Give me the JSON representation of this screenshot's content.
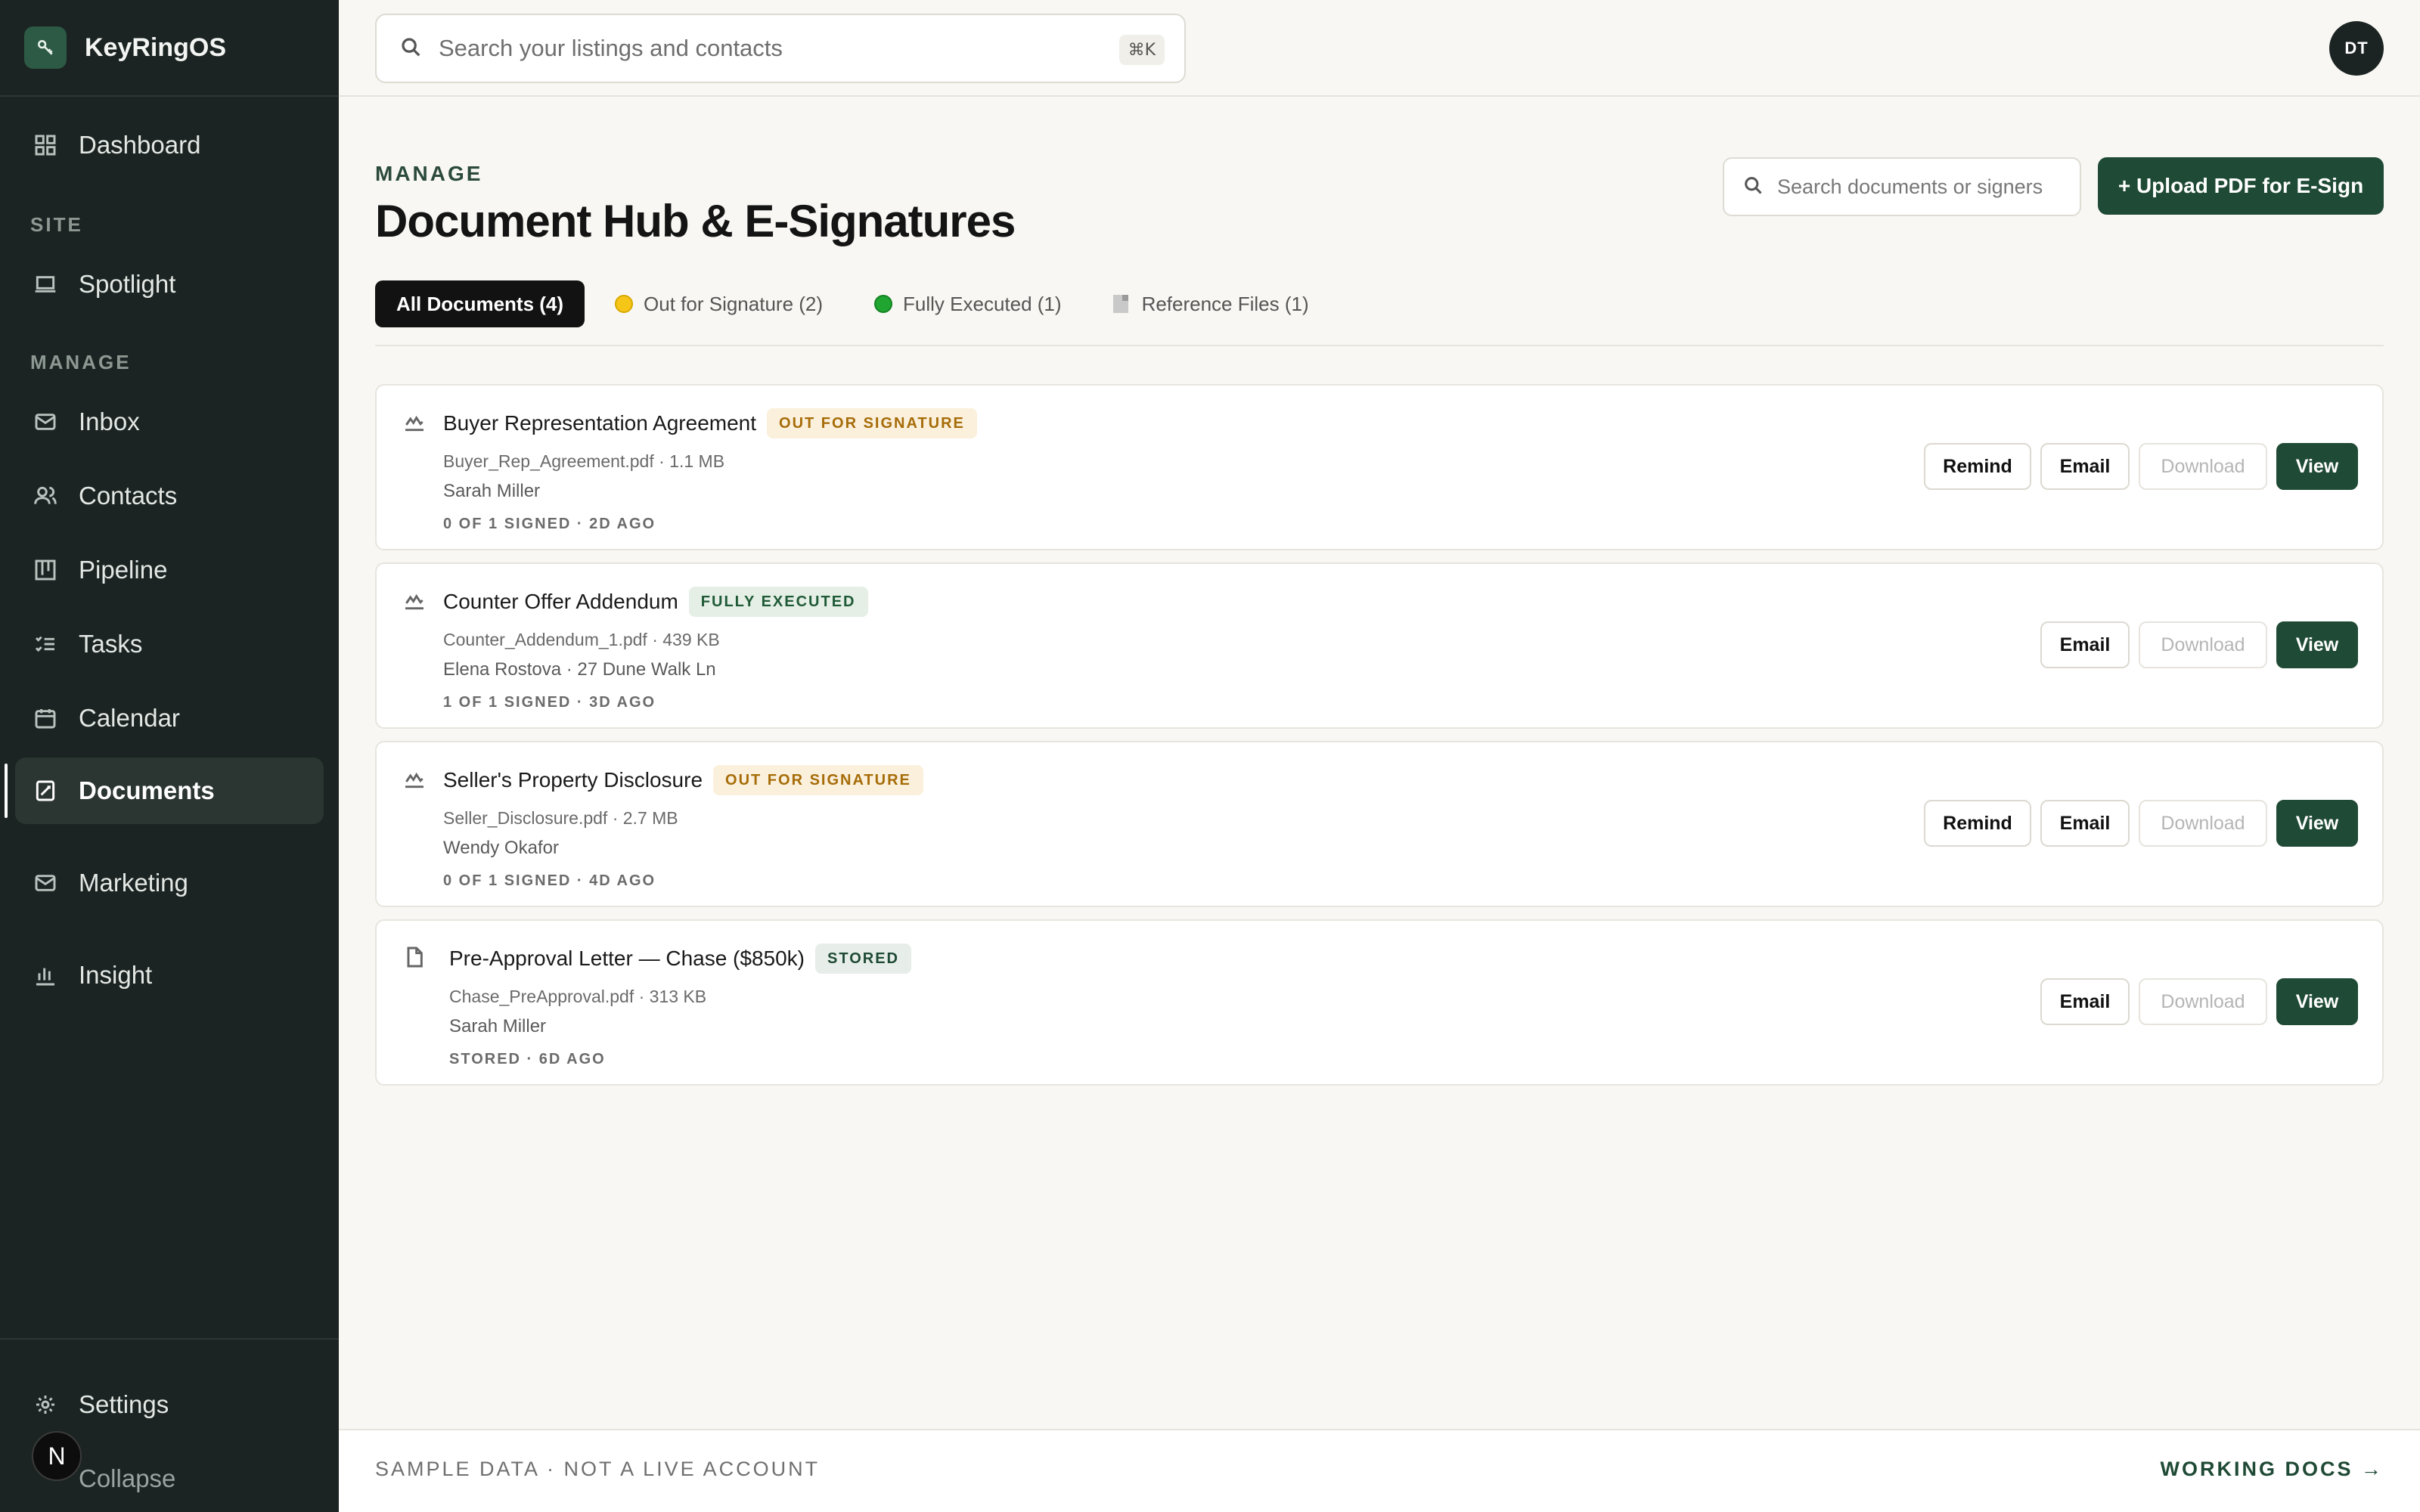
{
  "app": {
    "name": "KeyRingOS",
    "logo_icon": "key-icon"
  },
  "sidebar": {
    "items": [
      {
        "label": "Dashboard",
        "icon": "grid-icon"
      },
      {
        "label": "Spotlight",
        "icon": "laptop-icon"
      },
      {
        "label": "Inbox",
        "icon": "mail-icon"
      },
      {
        "label": "Contacts",
        "icon": "users-icon"
      },
      {
        "label": "Pipeline",
        "icon": "kanban-icon"
      },
      {
        "label": "Tasks",
        "icon": "checklist-icon"
      },
      {
        "label": "Calendar",
        "icon": "calendar-icon"
      },
      {
        "label": "Documents",
        "icon": "document-sign-icon",
        "active": true
      },
      {
        "label": "Marketing",
        "icon": "mail-icon"
      },
      {
        "label": "Insight",
        "icon": "bar-chart-icon"
      }
    ],
    "sections": {
      "site": "SITE",
      "manage": "MANAGE"
    },
    "bottom": {
      "settings": "Settings",
      "collapse": "Collapse",
      "badge": "N"
    }
  },
  "topbar": {
    "search_placeholder": "Search your listings and contacts",
    "shortcut": "⌘K",
    "avatar_initials": "DT"
  },
  "page": {
    "eyebrow": "MANAGE",
    "title": "Document Hub & E-Signatures",
    "doc_search_placeholder": "Search documents or signers",
    "upload_label": "+ Upload PDF for E-Sign"
  },
  "tabs": [
    {
      "label": "All Documents (4)",
      "active": true
    },
    {
      "label": "Out for Signature (2)",
      "icon": "yellow-dot"
    },
    {
      "label": "Fully Executed (1)",
      "icon": "green-dot"
    },
    {
      "label": "Reference Files (1)",
      "icon": "file-icon"
    }
  ],
  "documents": [
    {
      "title": "Buyer Representation Agreement",
      "status": "OUT FOR SIGNATURE",
      "file": "Buyer_Rep_Agreement.pdf · 1.1 MB",
      "signer": "Sarah Miller",
      "meta": "0 OF 1 SIGNED · 2D AGO",
      "actions": {
        "remind": "Remind",
        "email": "Email",
        "download": "Download",
        "view": "View"
      }
    },
    {
      "title": "Counter Offer Addendum",
      "status": "FULLY EXECUTED",
      "file": "Counter_Addendum_1.pdf · 439 KB",
      "signer": "Elena Rostova · 27 Dune Walk Ln",
      "meta": "1 OF 1 SIGNED · 3D AGO",
      "actions": {
        "email": "Email",
        "download": "Download",
        "view": "View"
      }
    },
    {
      "title": "Seller's Property Disclosure",
      "status": "OUT FOR SIGNATURE",
      "file": "Seller_Disclosure.pdf · 2.7 MB",
      "signer": "Wendy Okafor",
      "meta": "0 OF 1 SIGNED · 4D AGO",
      "actions": {
        "remind": "Remind",
        "email": "Email",
        "download": "Download",
        "view": "View"
      }
    },
    {
      "title": "Pre-Approval Letter — Chase ($850k)",
      "status": "STORED",
      "file": "Chase_PreApproval.pdf · 313 KB",
      "signer": "Sarah Miller",
      "meta": "STORED · 6D AGO",
      "actions": {
        "email": "Email",
        "download": "Download",
        "view": "View"
      }
    }
  ],
  "footer": {
    "note": "SAMPLE DATA · NOT A LIVE ACCOUNT",
    "link": "WORKING DOCS →"
  },
  "colors": {
    "sidebar_bg": "#1b2422",
    "accent": "#1f4a35",
    "pending": "#a66c08",
    "page_bg": "#f8f7f3"
  }
}
